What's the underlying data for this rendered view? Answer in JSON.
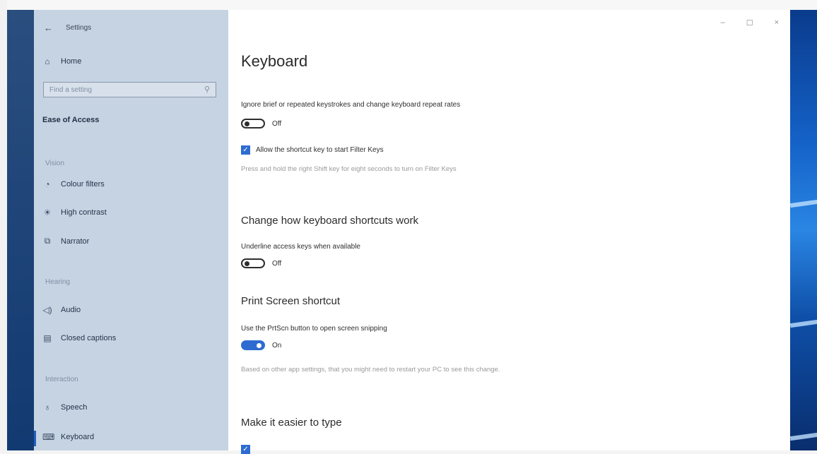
{
  "window": {
    "title": "Settings",
    "controls": {
      "minimize": "–",
      "maximize": "☐",
      "close": "×"
    }
  },
  "sidebar": {
    "home_label": "Home",
    "search_placeholder": "Find a setting",
    "section_title": "Ease of Access",
    "groups": [
      {
        "label": "Vision",
        "items": [
          {
            "icon": "colour-filters-icon",
            "glyph": "◔",
            "label": "Colour filters"
          },
          {
            "icon": "high-contrast-icon",
            "glyph": "☀",
            "label": "High contrast"
          },
          {
            "icon": "narrator-icon",
            "glyph": "⧉",
            "label": "Narrator"
          }
        ]
      },
      {
        "label": "Hearing",
        "items": [
          {
            "icon": "audio-icon",
            "glyph": "◁)",
            "label": "Audio"
          },
          {
            "icon": "closed-captions-icon",
            "glyph": "▤",
            "label": "Closed captions"
          }
        ]
      },
      {
        "label": "Interaction",
        "items": [
          {
            "icon": "speech-icon",
            "glyph": "♁",
            "label": "Speech"
          },
          {
            "icon": "keyboard-icon",
            "glyph": "⌨",
            "label": "Keyboard",
            "selected": true
          }
        ]
      }
    ]
  },
  "main": {
    "page_title": "Keyboard",
    "filter_keys": {
      "description": "Ignore brief or repeated keystrokes and change keyboard repeat rates",
      "toggle_state": "Off",
      "checkbox_label": "Allow the shortcut key to start Filter Keys",
      "help_text": "Press and hold the right Shift key for eight seconds to turn on Filter Keys"
    },
    "shortcuts": {
      "heading": "Change how keyboard shortcuts work",
      "underline_label": "Underline access keys when available",
      "toggle_state": "Off"
    },
    "print_screen": {
      "heading": "Print Screen shortcut",
      "label": "Use the PrtScn button to open screen snipping",
      "toggle_state": "On",
      "note": "Based on other app settings, that you might need to restart your PC to see this change."
    },
    "typing": {
      "heading": "Make it easier to type"
    }
  }
}
